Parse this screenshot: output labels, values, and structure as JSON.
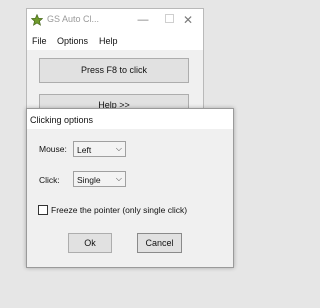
{
  "main_window": {
    "title": "GS Auto Cl...",
    "controls": {
      "minimize": "—",
      "close": "✕"
    },
    "menu": [
      "File",
      "Options",
      "Help"
    ],
    "press_button_label": "Press F8 to click",
    "help_button_label": "Help >>",
    "icon": "star-icon"
  },
  "dialog": {
    "title": "Clicking options",
    "mouse_label": "Mouse:",
    "mouse_value": "Left",
    "click_label": "Click:",
    "click_value": "Single",
    "dropdown_arrow": "⌵",
    "freeze_label": "Freeze the pointer (only single click)",
    "freeze_checked": false,
    "ok_label": "Ok",
    "cancel_label": "Cancel"
  },
  "colors": {
    "desktop": "#e6e6e6",
    "window_bg": "#f0f0f0",
    "button_face": "#e1e1e1"
  }
}
